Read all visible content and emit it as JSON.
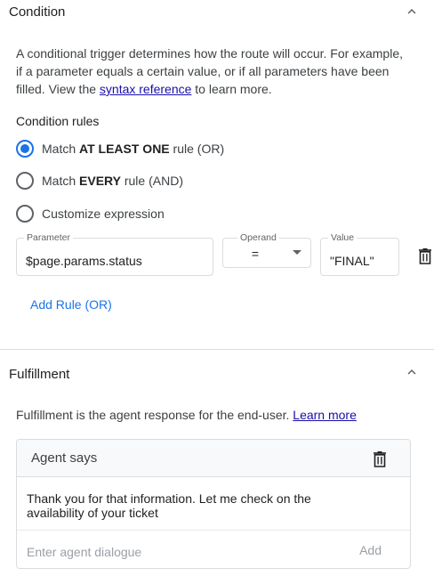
{
  "condition": {
    "title": "Condition",
    "description_part1": "A conditional trigger determines how the route will occur. For example, if a parameter equals a certain value, or if all parameters have been filled. View the ",
    "syntax_link": "syntax reference",
    "description_part2": " to learn more.",
    "rules_heading": "Condition rules",
    "options": [
      {
        "prefix": "Match ",
        "bold": "AT LEAST ONE",
        "suffix": " rule (OR)",
        "checked": true
      },
      {
        "prefix": "Match ",
        "bold": "EVERY",
        "suffix": " rule (AND)",
        "checked": false
      },
      {
        "prefix": "Customize expression",
        "bold": "",
        "suffix": "",
        "checked": false
      }
    ],
    "rule": {
      "parameter_label": "Parameter",
      "parameter_value": "$page.params.status",
      "operand_label": "Operand",
      "operand_value": "=",
      "value_label": "Value",
      "value_value": "\"FINAL\""
    },
    "add_rule_label": "Add Rule (OR)"
  },
  "fulfillment": {
    "title": "Fulfillment",
    "description": "Fulfillment is the agent response for the end-user. ",
    "learn_more": "Learn more",
    "agent_says_title": "Agent says",
    "agent_message_line1": "Thank you for that information. Let me check on the",
    "agent_message_line2": "availability of your ticket",
    "dialogue_placeholder": "Enter agent dialogue",
    "add_label": "Add"
  },
  "colors": {
    "accent": "#1a73e8",
    "link": "#1a0dab",
    "border": "#dadce0"
  }
}
